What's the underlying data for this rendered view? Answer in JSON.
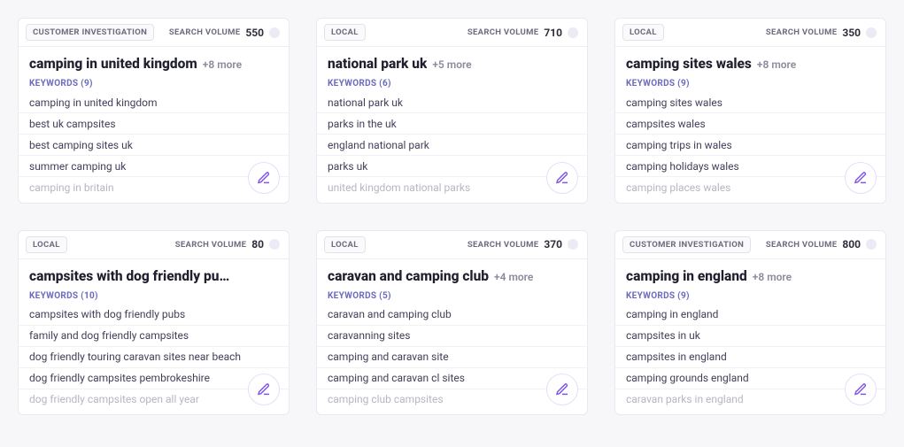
{
  "volume_label": "SEARCH VOLUME",
  "keywords_label_prefix": "KEYWORDS",
  "cards": [
    {
      "tag": "CUSTOMER INVESTIGATION",
      "volume": "550",
      "title": "camping in united kingdom",
      "more": "+8 more",
      "kw_count": "(9)",
      "keywords": [
        "camping in united kingdom",
        "best uk campsites",
        "best camping sites uk",
        "summer camping uk",
        "camping in britain"
      ]
    },
    {
      "tag": "LOCAL",
      "volume": "710",
      "title": "national park uk",
      "more": "+5 more",
      "kw_count": "(6)",
      "keywords": [
        "national park uk",
        "parks in the uk",
        "england national park",
        "parks uk",
        "united kingdom national parks"
      ]
    },
    {
      "tag": "LOCAL",
      "volume": "350",
      "title": "camping sites wales",
      "more": "+8 more",
      "kw_count": "(9)",
      "keywords": [
        "camping sites wales",
        "campsites wales",
        "camping trips in wales",
        "camping holidays wales",
        "camping places wales"
      ]
    },
    {
      "tag": "LOCAL",
      "volume": "80",
      "title": "campsites with dog friendly pubs…",
      "more": "",
      "kw_count": "(10)",
      "keywords": [
        "campsites with dog friendly pubs",
        "family and dog friendly campsites",
        "dog friendly touring caravan sites near beach",
        "dog friendly campsites pembrokeshire",
        "dog friendly campsites open all year"
      ]
    },
    {
      "tag": "LOCAL",
      "volume": "370",
      "title": "caravan and camping club",
      "more": "+4 more",
      "kw_count": "(5)",
      "keywords": [
        "caravan and camping club",
        "caravanning sites",
        "camping and caravan site",
        "camping and caravan cl sites",
        "camping club campsites"
      ]
    },
    {
      "tag": "CUSTOMER INVESTIGATION",
      "volume": "800",
      "title": "camping in england",
      "more": "+8 more",
      "kw_count": "(9)",
      "keywords": [
        "camping in england",
        "campsites in uk",
        "campsites in england",
        "camping grounds england",
        "caravan parks in england"
      ]
    }
  ]
}
